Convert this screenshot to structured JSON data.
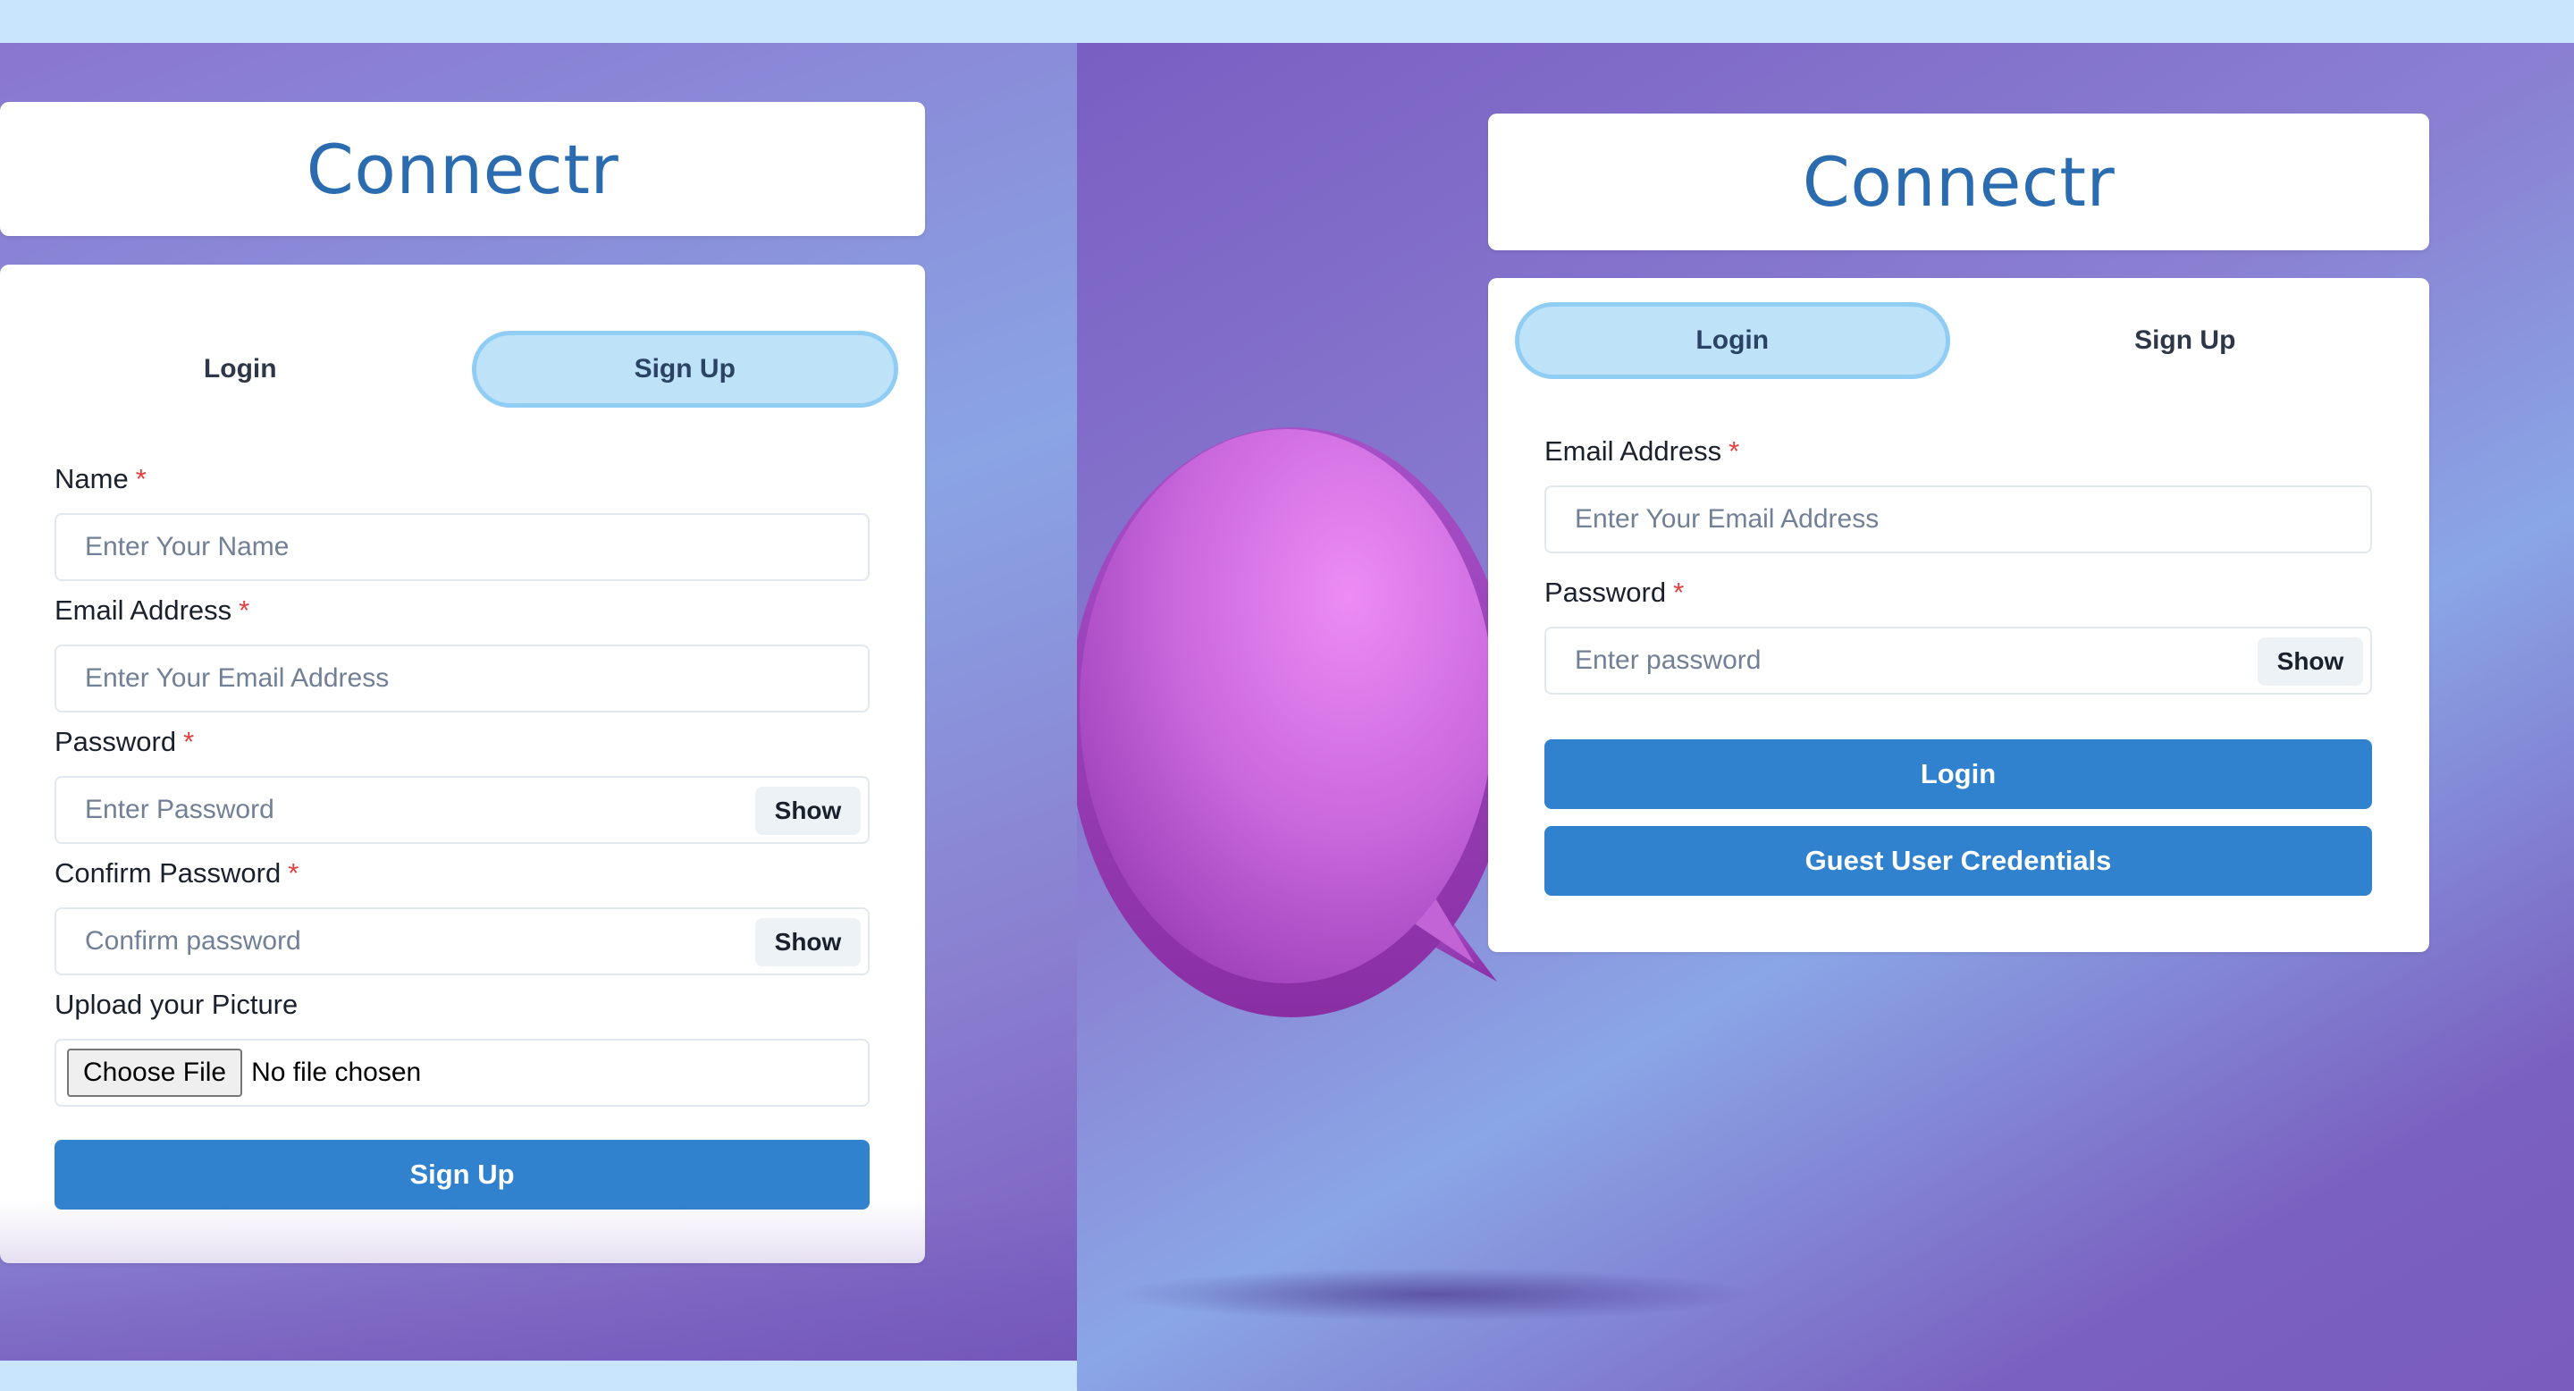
{
  "signup_view": {
    "app_title": "Connectr",
    "tabs": {
      "login": "Login",
      "signup": "Sign Up"
    },
    "active_tab": "signup",
    "name_label": "Name",
    "name_placeholder": "Enter Your Name",
    "email_label": "Email Address",
    "email_placeholder": "Enter Your Email Address",
    "password_label": "Password",
    "password_placeholder": "Enter Password",
    "password_show": "Show",
    "confirm_label": "Confirm Password",
    "confirm_placeholder": "Confirm password",
    "confirm_show": "Show",
    "upload_label": "Upload your Picture",
    "choose_file": "Choose File",
    "file_status": "No file chosen",
    "submit_label": "Sign Up"
  },
  "login_view": {
    "app_title": "Connectr",
    "tabs": {
      "login": "Login",
      "signup": "Sign Up"
    },
    "active_tab": "login",
    "email_label": "Email Address",
    "email_placeholder": "Enter Your Email Address",
    "password_label": "Password",
    "password_placeholder": "Enter password",
    "password_show": "Show",
    "login_button": "Login",
    "guest_button": "Guest User Credentials"
  },
  "required_marker": "*",
  "colors": {
    "accent": "#3182ce",
    "title": "#2b6cb0",
    "active_tab_bg": "#bee3f8",
    "active_tab_border": "#90cdf4",
    "required": "#e53e3e",
    "page_bg": "#c8e5fd"
  },
  "icons": [
    "chat-bubble-icon"
  ]
}
